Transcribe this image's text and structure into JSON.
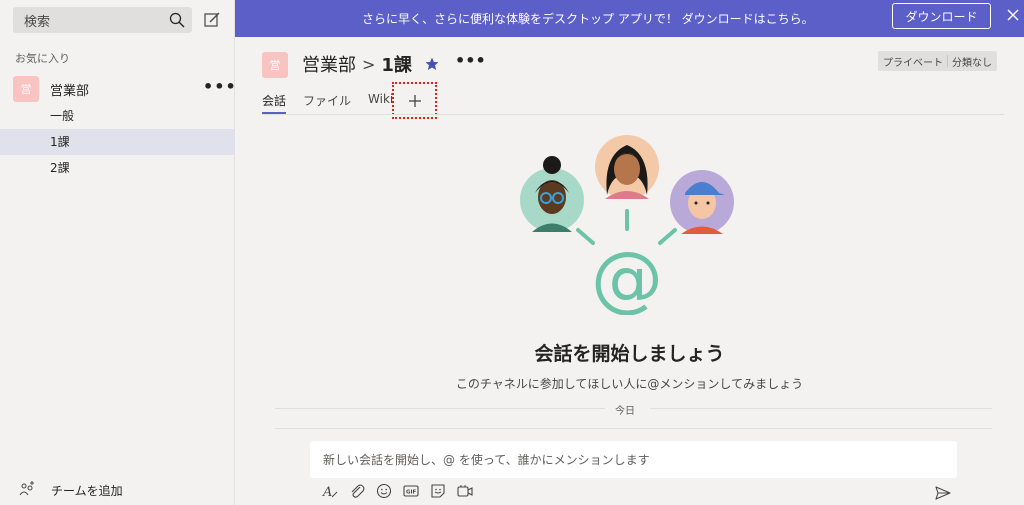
{
  "sidebar": {
    "search_placeholder": "検索",
    "favorites_label": "お気に入り",
    "team": {
      "avatar_text": "営",
      "name": "営業部",
      "more": "•••"
    },
    "channels": [
      {
        "label": "一般",
        "active": false
      },
      {
        "label": "1課",
        "active": true
      },
      {
        "label": "2課",
        "active": false
      }
    ],
    "add_team_label": "チームを追加"
  },
  "banner": {
    "text": "さらに早く、さらに便利な体験をデスクトップ アプリで！ ダウンロードはこちら。",
    "button_label": "ダウンロード"
  },
  "header": {
    "avatar_text": "営",
    "team_name": "営業部",
    "separator": ">",
    "channel_name": "1課",
    "more": "•••",
    "privacy_left": "プライベート",
    "privacy_right": "分類なし"
  },
  "tabs": [
    {
      "label": "会話",
      "active": true
    },
    {
      "label": "ファイル",
      "active": false
    },
    {
      "label": "Wiki",
      "active": false
    }
  ],
  "tab_add_symbol": "+",
  "empty_state": {
    "title": "会話を開始しましょう",
    "subtitle": "このチャネルに参加してほしい人に@メンションしてみましょう"
  },
  "divider_label": "今日",
  "compose": {
    "placeholder": "新しい会話を開始し、@ を使って、誰かにメンションします"
  },
  "colors": {
    "accent": "#5b5fc7",
    "team_avatar": "#f7c4c1",
    "highlight_box": "#e02020",
    "at_symbol": "#6cc3a8"
  },
  "icons": {
    "toolbar": [
      "format-icon",
      "attach-icon",
      "emoji-icon",
      "gif-icon",
      "sticker-icon",
      "meet-icon"
    ]
  }
}
